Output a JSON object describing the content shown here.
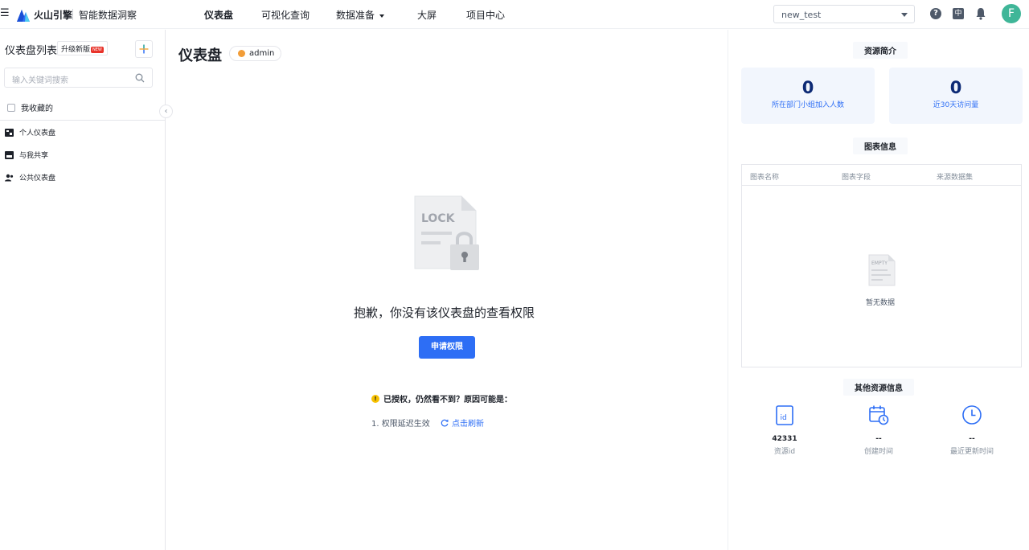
{
  "header": {
    "brand": "火山引擎",
    "product": "智能数据洞察",
    "nav": [
      "仪表盘",
      "可视化查询",
      "数据准备",
      "大屏",
      "项目中心"
    ],
    "project": "new_test",
    "lang": "中",
    "avatar_letter": "F"
  },
  "sidebar": {
    "title": "仪表盘列表",
    "upgrade": "升级新版",
    "upgrade_badge": "NEW",
    "search_placeholder": "输入关键词搜索",
    "favorites": "我收藏的",
    "items": [
      "个人仪表盘",
      "与我共享",
      "公共仪表盘"
    ]
  },
  "main": {
    "title": "仪表盘",
    "owner": "admin",
    "lock_word": "LOCK",
    "deny": "抱歉，你没有该仪表盘的查看权限",
    "apply": "申请权限",
    "hint_title": "已授权，仍然看不到？原因可能是：",
    "hint_item": "1. 权限延迟生效",
    "refresh": "点击刷新"
  },
  "resource": {
    "title": "资源简介",
    "stats": [
      {
        "value": "0",
        "label": "所在部门小组加入人数"
      },
      {
        "value": "0",
        "label": "近30天访问量"
      }
    ],
    "chart_info_title": "图表信息",
    "columns": [
      "图表名称",
      "图表字段",
      "来源数据集"
    ],
    "empty_word": "EMPTY",
    "empty": "暂无数据",
    "other_title": "其他资源信息",
    "meta": [
      {
        "value": "42331",
        "label": "资源id",
        "icon": "id-icon"
      },
      {
        "value": "--",
        "label": "创建时间",
        "icon": "calendar-clock-icon"
      },
      {
        "value": "--",
        "label": "最近更新时间",
        "icon": "clock-icon"
      }
    ]
  },
  "colors": {
    "primary": "#2d6ef5",
    "stat_bg": "#f2f6fd",
    "avatar": "#3fb698",
    "warning": "#f7c100"
  }
}
